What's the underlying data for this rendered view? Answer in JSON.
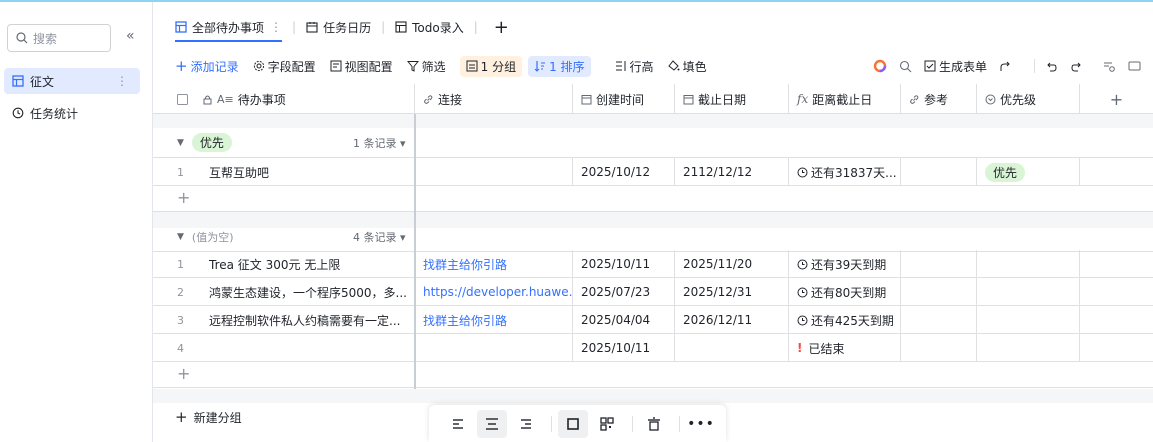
{
  "sidebar": {
    "search_placeholder": "搜索",
    "collapse_label": "«",
    "items": [
      {
        "label": "征文",
        "active": true
      },
      {
        "label": "任务统计",
        "active": false
      }
    ]
  },
  "tabs": [
    {
      "label": "全部待办事项",
      "active": true
    },
    {
      "label": "任务日历",
      "active": false
    },
    {
      "label": "Todo录入",
      "active": false
    }
  ],
  "toolbar": {
    "add_record": "添加记录",
    "field_config": "字段配置",
    "view_config": "视图配置",
    "filter": "筛选",
    "group": "1 分组",
    "sort": "1 排序",
    "row_height": "行高",
    "fill_color": "填色",
    "generate_form": "生成表单"
  },
  "columns": [
    "待办事项",
    "连接",
    "创建时间",
    "截止日期",
    "距离截止日",
    "参考",
    "优先级"
  ],
  "groups": [
    {
      "name": "优先",
      "count_label": "1 条记录",
      "rows": [
        {
          "index": "1",
          "title": "互帮互助吧",
          "link": "",
          "created": "2025/10/12",
          "deadline": "2112/12/12",
          "remaining": "还有31837天...",
          "ref": "",
          "priority": "优先"
        }
      ]
    },
    {
      "name": "(值为空)",
      "count_label": "4 条记录",
      "rows": [
        {
          "index": "1",
          "title": "Trea 征文 300元 无上限",
          "link": "找群主给你引路",
          "created": "2025/10/11",
          "deadline": "2025/11/20",
          "remaining": "还有39天到期",
          "ref": "",
          "priority": ""
        },
        {
          "index": "2",
          "title": "鸿蒙生态建设，一个程序5000，多...",
          "link": "https://developer.huawe...",
          "created": "2025/07/23",
          "deadline": "2025/12/31",
          "remaining": "还有80天到期",
          "ref": "",
          "priority": ""
        },
        {
          "index": "3",
          "title": "远程控制软件私人约稿需要有一定...",
          "link": "找群主给你引路",
          "created": "2025/04/04",
          "deadline": "2026/12/11",
          "remaining": "还有425天到期",
          "ref": "",
          "priority": ""
        },
        {
          "index": "4",
          "title": "",
          "link": "",
          "created": "2025/10/11",
          "deadline": "",
          "remaining": "已结束",
          "ref": "",
          "priority": ""
        }
      ]
    }
  ],
  "new_group": "新建分组",
  "colors": {
    "accent": "#3370ff",
    "green_tag": "#d9f5d6",
    "danger": "#f54a45"
  }
}
